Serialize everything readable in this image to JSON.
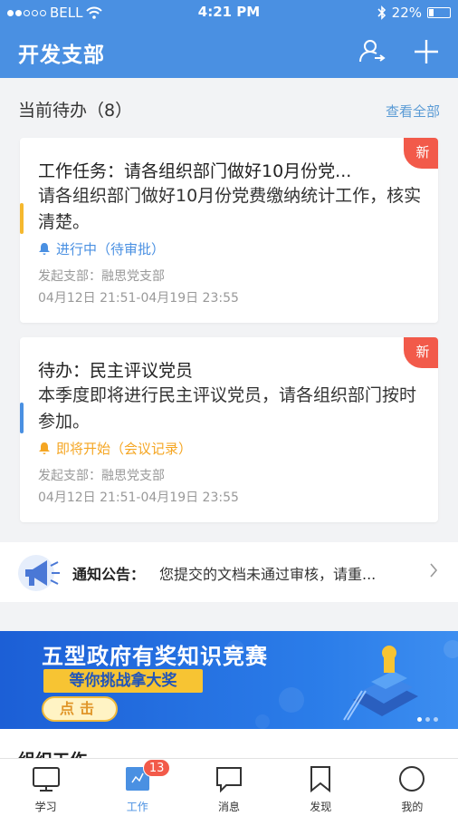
{
  "status_bar": {
    "carrier": "BELL",
    "time": "4:21 PM",
    "battery": "22%"
  },
  "header": {
    "title": "开发支部"
  },
  "todo": {
    "title": "当前待办（8）",
    "view_all": "查看全部",
    "cards": [
      {
        "badge": "新",
        "title": "工作任务：请各组织部门做好10月份党...",
        "desc": "请各组织部门做好10月份党费缴纳统计工作，核实清楚。",
        "status": "进行中（待审批）",
        "status_color": "#4a90e2",
        "branch": "发起支部：融思党支部",
        "time": "04月12日 21:51-04月19日 23:55",
        "bar_color": "#f5b82e"
      },
      {
        "badge": "新",
        "title": "待办：民主评议党员",
        "desc": "本季度即将进行民主评议党员，请各组织部门按时参加。",
        "status": "即将开始（会议记录）",
        "status_color": "#f5a623",
        "branch": "发起支部：融思党支部",
        "time": "04月12日 21:51-04月19日 23:55",
        "bar_color": "#4a90e2"
      }
    ]
  },
  "notice": {
    "label": "通知公告：",
    "text": "您提交的文档未通过审核，请重..."
  },
  "banner": {
    "title": "五型政府有奖知识竞赛",
    "subtitle": "等你挑战拿大奖",
    "button": "点击"
  },
  "next_section": {
    "title": "组织工作"
  },
  "tabs": [
    {
      "label": "学习",
      "icon": "monitor-icon"
    },
    {
      "label": "工作",
      "icon": "work-icon",
      "badge": "13",
      "active": true
    },
    {
      "label": "消息",
      "icon": "message-icon"
    },
    {
      "label": "发现",
      "icon": "bookmark-icon"
    },
    {
      "label": "我的",
      "icon": "profile-icon"
    }
  ],
  "colors": {
    "primary": "#4a90e2",
    "badge_red": "#f25a4a",
    "background": "#f2f3f5"
  }
}
